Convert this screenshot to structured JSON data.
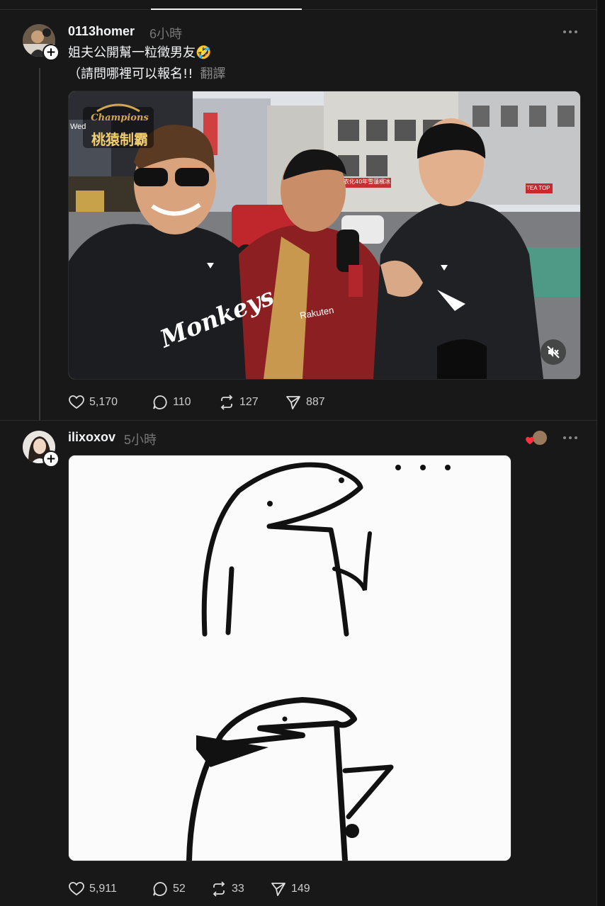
{
  "posts": [
    {
      "username": "0113homer",
      "time": "6小時",
      "text_line1": "姐夫公開幫一粒徵男友🤣",
      "text_line2": "（請問哪裡可以報名!!",
      "translate_label": "翻譯",
      "media": {
        "type": "video",
        "overlay_logo_line1": "Champions",
        "overlay_logo_line2": "桃猿制霸",
        "shop_sign": "Wed",
        "storefront_sign": "衣化40年雪蓮檳冰",
        "store_sign_right": "TEA TOP",
        "hoodie_text": "Monkeys",
        "jacket_text": "Rakuten",
        "muted": true
      },
      "stats": {
        "likes": "5,170",
        "replies": "110",
        "reposts": "127",
        "shares": "887"
      }
    },
    {
      "username": "ilixoxov",
      "time": "5小時",
      "media": {
        "type": "image",
        "dots": "• • •"
      },
      "stats": {
        "likes": "5,911",
        "replies": "52",
        "reposts": "33",
        "shares": "149"
      }
    }
  ],
  "colors": {
    "background": "#181818",
    "text": "#f3f5f7",
    "muted": "#777777",
    "heart_reaction": "#ff3040"
  },
  "icons": [
    "heart-icon",
    "comment-icon",
    "repost-icon",
    "share-icon",
    "more-icon",
    "mute-icon",
    "follow-plus-icon"
  ]
}
